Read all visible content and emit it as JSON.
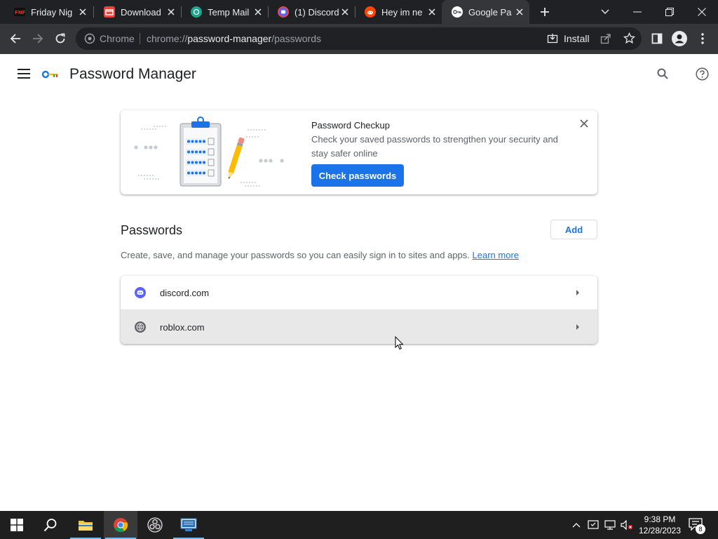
{
  "tabs": [
    {
      "title": "Friday Nig",
      "icon": "fnf-icon",
      "close": "×"
    },
    {
      "title": "Download",
      "icon": "download-app-icon",
      "close": "×"
    },
    {
      "title": "Temp Mail",
      "icon": "temp-mail-icon",
      "close": "×"
    },
    {
      "title": "(1) Discord",
      "icon": "discord-icon",
      "close": "×"
    },
    {
      "title": "Hey im ne",
      "icon": "reddit-icon",
      "close": "×"
    },
    {
      "title": "Google Pa",
      "icon": "google-password-icon",
      "close": "×",
      "active": true
    }
  ],
  "omnibox": {
    "chrome_label": "Chrome",
    "url_scheme": "chrome://",
    "url_host": "password-manager",
    "url_path": "/passwords",
    "install_label": "Install"
  },
  "header": {
    "title": "Password Manager"
  },
  "checkup": {
    "title": "Password Checkup",
    "description": "Check your saved passwords to strengthen your security and stay safer online",
    "button": "Check passwords"
  },
  "passwords": {
    "heading": "Passwords",
    "add_label": "Add",
    "description": "Create, save, and manage your passwords so you can easily sign in to sites and apps.",
    "learn_more": "Learn more",
    "items": [
      {
        "site": "discord.com",
        "icon": "discord-icon"
      },
      {
        "site": "roblox.com",
        "icon": "globe-icon"
      }
    ]
  },
  "taskbar": {
    "time": "9:38 PM",
    "date": "12/28/2023",
    "notification_count": "8"
  },
  "colors": {
    "accent": "#1a73e8",
    "tabstrip": "#202124",
    "toolbar": "#35363a"
  }
}
